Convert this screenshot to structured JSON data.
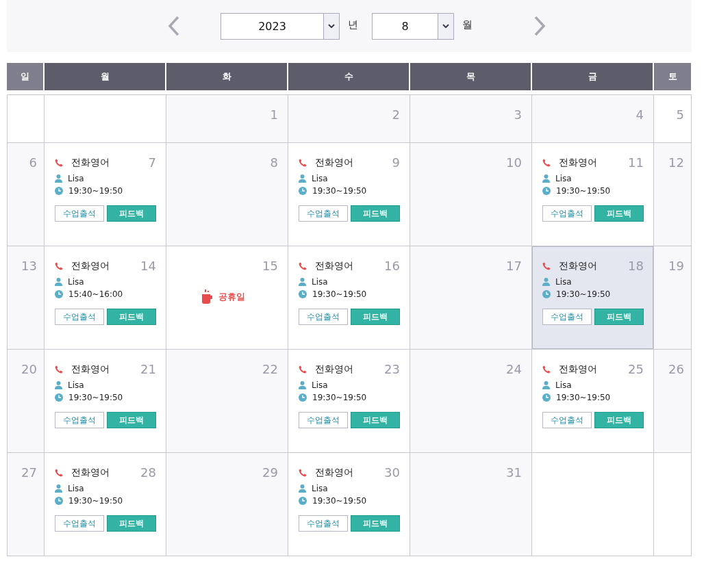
{
  "nav": {
    "year": "2023",
    "year_unit": "년",
    "month": "8",
    "month_unit": "월"
  },
  "weekdays": [
    {
      "label": "일"
    },
    {
      "label": "월"
    },
    {
      "label": "화"
    },
    {
      "label": "수"
    },
    {
      "label": "목"
    },
    {
      "label": "금"
    },
    {
      "label": "토"
    }
  ],
  "holiday_label": "공휴일",
  "weeks": [
    [
      {
        "kind": "blank"
      },
      {
        "kind": "blank"
      },
      {
        "kind": "day",
        "day": "1",
        "selected": false
      },
      {
        "kind": "day",
        "day": "2",
        "selected": false
      },
      {
        "kind": "day",
        "day": "3",
        "selected": false
      },
      {
        "kind": "day",
        "day": "4",
        "selected": false
      },
      {
        "kind": "day",
        "day": "5",
        "selected": false
      }
    ],
    [
      {
        "kind": "day",
        "day": "6",
        "selected": false
      },
      {
        "kind": "lesson",
        "day": "7",
        "selected": false,
        "title": "전화영어",
        "teacher": "Lisa",
        "time": "19:30~19:50",
        "buttons": [
          {
            "label": "수업출석",
            "kind": "outline"
          },
          {
            "label": "피드백",
            "kind": "primary"
          }
        ]
      },
      {
        "kind": "day",
        "day": "8",
        "selected": false
      },
      {
        "kind": "lesson",
        "day": "9",
        "selected": false,
        "title": "전화영어",
        "teacher": "Lisa",
        "time": "19:30~19:50",
        "buttons": [
          {
            "label": "수업출석",
            "kind": "outline"
          },
          {
            "label": "피드백",
            "kind": "primary"
          }
        ]
      },
      {
        "kind": "day",
        "day": "10",
        "selected": false
      },
      {
        "kind": "lesson",
        "day": "11",
        "selected": false,
        "title": "전화영어",
        "teacher": "Lisa",
        "time": "19:30~19:50",
        "buttons": [
          {
            "label": "수업출석",
            "kind": "outline"
          },
          {
            "label": "피드백",
            "kind": "primary"
          }
        ]
      },
      {
        "kind": "day",
        "day": "12",
        "selected": false
      }
    ],
    [
      {
        "kind": "day",
        "day": "13",
        "selected": false
      },
      {
        "kind": "lesson",
        "day": "14",
        "selected": false,
        "title": "전화영어",
        "teacher": "Lisa",
        "time": "15:40~16:00",
        "buttons": [
          {
            "label": "수업출석",
            "kind": "outline"
          },
          {
            "label": "피드백",
            "kind": "primary"
          }
        ]
      },
      {
        "kind": "holiday",
        "day": "15",
        "selected": false
      },
      {
        "kind": "lesson",
        "day": "16",
        "selected": false,
        "title": "전화영어",
        "teacher": "Lisa",
        "time": "19:30~19:50",
        "buttons": [
          {
            "label": "수업출석",
            "kind": "outline"
          },
          {
            "label": "피드백",
            "kind": "primary"
          }
        ]
      },
      {
        "kind": "day",
        "day": "17",
        "selected": false
      },
      {
        "kind": "lesson",
        "day": "18",
        "selected": true,
        "title": "전화영어",
        "teacher": "Lisa",
        "time": "19:30~19:50",
        "buttons": [
          {
            "label": "수업출석",
            "kind": "outline"
          },
          {
            "label": "피드백",
            "kind": "primary"
          }
        ]
      },
      {
        "kind": "day",
        "day": "19",
        "selected": false
      }
    ],
    [
      {
        "kind": "day",
        "day": "20",
        "selected": false
      },
      {
        "kind": "lesson",
        "day": "21",
        "selected": false,
        "title": "전화영어",
        "teacher": "Lisa",
        "time": "19:30~19:50",
        "buttons": [
          {
            "label": "수업출석",
            "kind": "outline"
          },
          {
            "label": "피드백",
            "kind": "primary"
          }
        ]
      },
      {
        "kind": "day",
        "day": "22",
        "selected": false
      },
      {
        "kind": "lesson",
        "day": "23",
        "selected": false,
        "title": "전화영어",
        "teacher": "Lisa",
        "time": "19:30~19:50",
        "buttons": [
          {
            "label": "수업출석",
            "kind": "outline"
          },
          {
            "label": "피드백",
            "kind": "primary"
          }
        ]
      },
      {
        "kind": "day",
        "day": "24",
        "selected": false
      },
      {
        "kind": "lesson",
        "day": "25",
        "selected": false,
        "title": "전화영어",
        "teacher": "Lisa",
        "time": "19:30~19:50",
        "buttons": [
          {
            "label": "수업출석",
            "kind": "outline"
          },
          {
            "label": "피드백",
            "kind": "primary"
          }
        ]
      },
      {
        "kind": "day",
        "day": "26",
        "selected": false
      }
    ],
    [
      {
        "kind": "day",
        "day": "27",
        "selected": false
      },
      {
        "kind": "lesson",
        "day": "28",
        "selected": false,
        "title": "전화영어",
        "teacher": "Lisa",
        "time": "19:30~19:50",
        "buttons": [
          {
            "label": "수업출석",
            "kind": "outline"
          },
          {
            "label": "피드백",
            "kind": "primary"
          }
        ]
      },
      {
        "kind": "day",
        "day": "29",
        "selected": false
      },
      {
        "kind": "lesson",
        "day": "30",
        "selected": false,
        "title": "전화영어",
        "teacher": "Lisa",
        "time": "19:30~19:50",
        "buttons": [
          {
            "label": "수업출석",
            "kind": "outline"
          },
          {
            "label": "피드백",
            "kind": "primary"
          }
        ]
      },
      {
        "kind": "day",
        "day": "31",
        "selected": false
      },
      {
        "kind": "blank"
      },
      {
        "kind": "blank"
      }
    ]
  ]
}
